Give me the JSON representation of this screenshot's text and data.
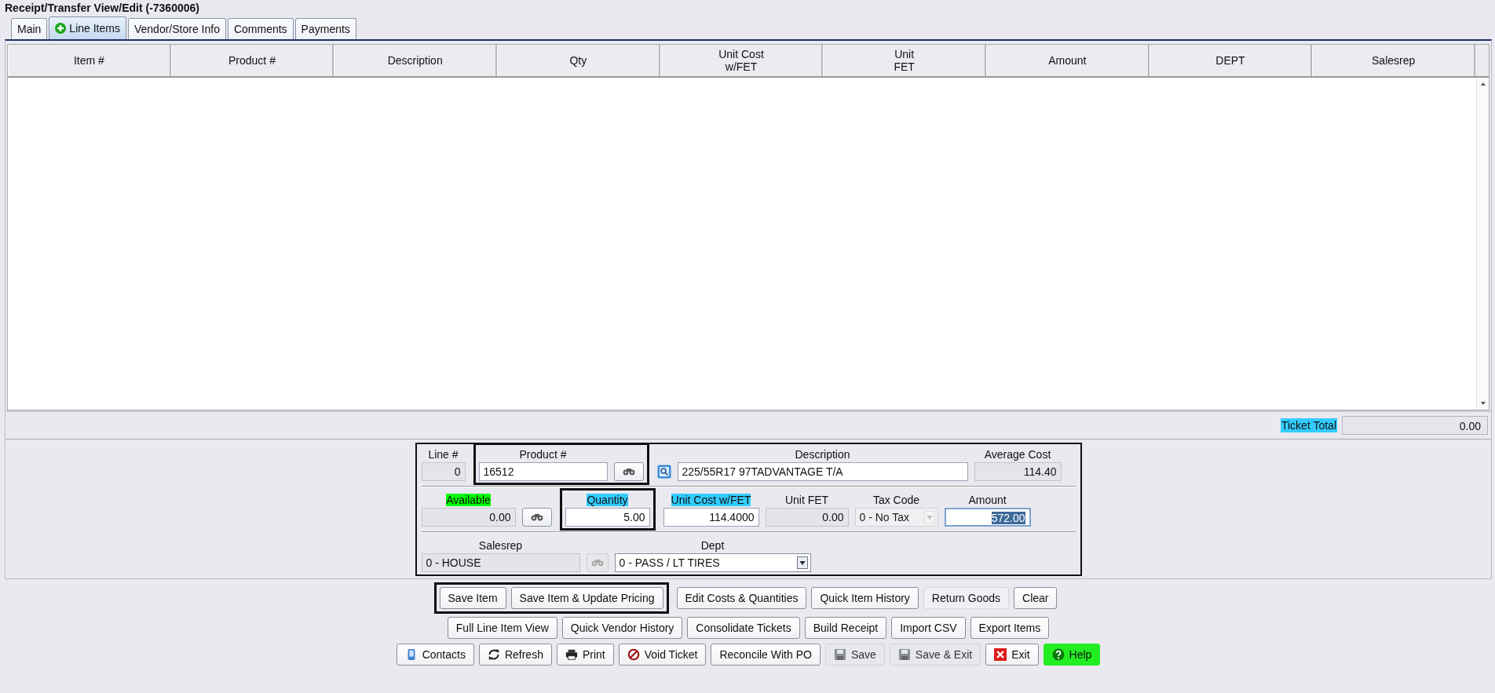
{
  "title": "Receipt/Transfer View/Edit  (-7360006)",
  "tabs": [
    {
      "label": "Main",
      "selected": false,
      "icon": false
    },
    {
      "label": "Line Items",
      "selected": true,
      "icon": true
    },
    {
      "label": "Vendor/Store Info",
      "selected": false,
      "icon": false
    },
    {
      "label": "Comments",
      "selected": false,
      "icon": false
    },
    {
      "label": "Payments",
      "selected": false,
      "icon": false
    }
  ],
  "table": {
    "columns": [
      "Item #",
      "Product #",
      "Description",
      "Qty",
      "Unit Cost\nw/FET",
      "Unit\nFET",
      "Amount",
      "DEPT",
      "Salesrep"
    ]
  },
  "ticket_total": {
    "label": "Ticket Total",
    "color": "#33ccff",
    "value": "0.00"
  },
  "form": {
    "rows": [
      [
        {
          "outlined": false,
          "items": [
            {
              "kind": "number",
              "label": "Line #",
              "value": "0",
              "disabled": true
            }
          ]
        },
        {
          "outlined": true,
          "items": [
            {
              "kind": "text",
              "label": "Product #",
              "value": "16512",
              "disabled": false
            },
            {
              "kind": "lookup",
              "disabled": false
            }
          ]
        },
        {
          "outlined": false,
          "items": [
            {
              "kind": "search",
              "disabled": false
            },
            {
              "kind": "text",
              "label": "Description",
              "value": "225/55R17 97TADVANTAGE T/A",
              "disabled": false
            },
            {
              "kind": "number",
              "label": "Average Cost",
              "value": "114.40",
              "disabled": true
            }
          ]
        }
      ],
      [
        {
          "outlined": false,
          "items": [
            {
              "kind": "number",
              "label": "Available",
              "color": "#00ff00",
              "value": "0.00",
              "disabled": true
            },
            {
              "kind": "lookup",
              "disabled": false
            }
          ]
        },
        {
          "outlined": true,
          "items": [
            {
              "kind": "number",
              "label": "Quantity",
              "color": "#33ccff",
              "value": "5.00",
              "disabled": false
            }
          ]
        },
        {
          "outlined": false,
          "items": [
            {
              "kind": "number",
              "label": "Unit Cost w/FET",
              "color": "#33ccff",
              "value": "114.4000",
              "disabled": false
            },
            {
              "kind": "number",
              "label": "Unit FET",
              "value": "0.00",
              "disabled": true
            },
            {
              "kind": "select",
              "label": "Tax Code",
              "value": "0 - No Tax",
              "disabled": true
            },
            {
              "kind": "number",
              "label": "Amount",
              "value": "572.00",
              "disabled": false,
              "text_selected": true
            }
          ]
        }
      ],
      [
        {
          "outlined": false,
          "items": [
            {
              "kind": "text",
              "label": "Salesrep",
              "value": "0 - HOUSE",
              "disabled": true
            },
            {
              "kind": "lookup",
              "disabled": true
            },
            {
              "kind": "select",
              "label": "Dept",
              "value": "0 - PASS / LT TIRES",
              "disabled": false
            }
          ]
        }
      ]
    ]
  },
  "button_rows": [
    [
      {
        "outlined": true,
        "buttons": [
          {
            "label": "Save Item",
            "kind": "plain",
            "disabled": false
          },
          {
            "label": "Save Item & Update Pricing",
            "kind": "plain",
            "disabled": false
          }
        ]
      },
      {
        "outlined": false,
        "buttons": [
          {
            "label": "Edit Costs & Quantities",
            "kind": "plain",
            "disabled": false
          },
          {
            "label": "Quick Item History",
            "kind": "plain",
            "disabled": false
          },
          {
            "label": "Return Goods",
            "kind": "flat",
            "disabled": false
          },
          {
            "label": "Clear",
            "kind": "plain",
            "disabled": false
          }
        ]
      }
    ],
    [
      {
        "outlined": false,
        "buttons": [
          {
            "label": "Full Line Item View",
            "kind": "plain",
            "disabled": false
          },
          {
            "label": "Quick Vendor History",
            "kind": "plain",
            "disabled": false
          },
          {
            "label": "Consolidate Tickets",
            "kind": "plain",
            "disabled": false
          },
          {
            "label": "Build Receipt",
            "kind": "plain",
            "disabled": false
          },
          {
            "label": "Import CSV",
            "kind": "plain",
            "disabled": false
          },
          {
            "label": "Export Items",
            "kind": "plain",
            "disabled": false
          }
        ]
      }
    ],
    [
      {
        "outlined": false,
        "buttons": [
          {
            "label": "Contacts",
            "kind": "contacts",
            "disabled": false
          },
          {
            "label": "Refresh",
            "kind": "refresh",
            "disabled": false
          },
          {
            "label": "Print",
            "kind": "print",
            "disabled": false
          },
          {
            "label": "Void Ticket",
            "kind": "void",
            "disabled": false
          },
          {
            "label": "Reconcile With PO",
            "kind": "plain",
            "disabled": false
          },
          {
            "label": "Save",
            "kind": "save",
            "disabled": true
          },
          {
            "label": "Save & Exit",
            "kind": "save",
            "disabled": true
          },
          {
            "label": "Exit",
            "kind": "exit",
            "disabled": false
          },
          {
            "label": "Help",
            "kind": "help",
            "disabled": false,
            "color": "#22ee22"
          }
        ]
      }
    ]
  ]
}
